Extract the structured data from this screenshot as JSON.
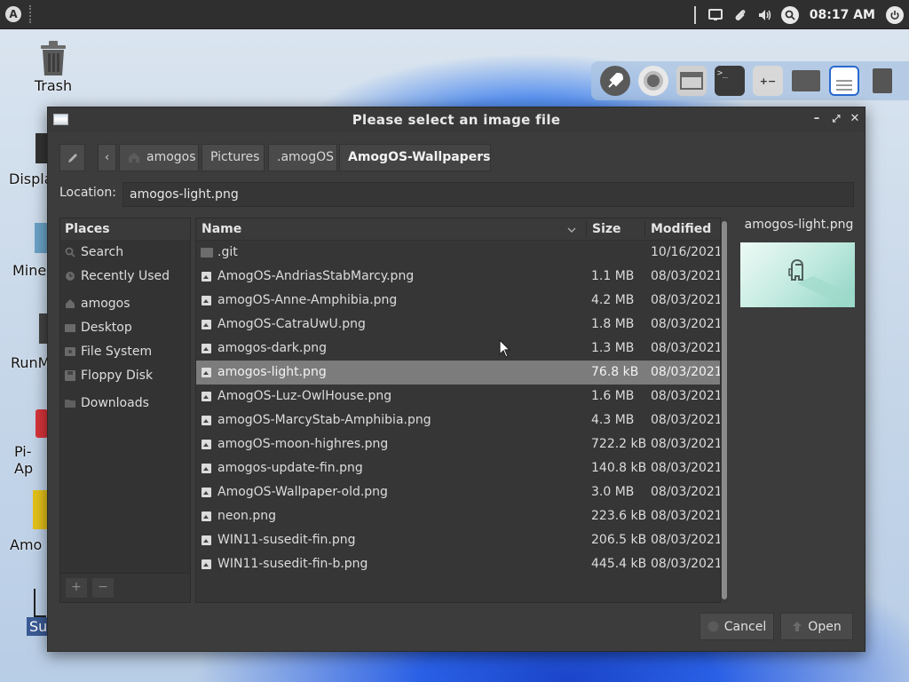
{
  "panel": {
    "clock": "08:17 AM"
  },
  "desktop": {
    "icons": [
      {
        "label": "Trash"
      },
      {
        "label": "Displa"
      },
      {
        "label": "Mine"
      },
      {
        "label": "RunM"
      },
      {
        "label": "Pi-Ap"
      },
      {
        "label": "Amo"
      },
      {
        "label": "Su"
      }
    ]
  },
  "dialog": {
    "title": "Please select an image file",
    "breadcrumb": [
      "amogos",
      "Pictures",
      ".amogOS",
      "AmogOS-Wallpapers"
    ],
    "location_label": "Location:",
    "location_value": "amogos-light.png",
    "places": {
      "header": "Places",
      "items": [
        "Search",
        "Recently Used",
        "amogos",
        "Desktop",
        "File System",
        "Floppy Disk",
        "Downloads"
      ],
      "add_label": "+",
      "remove_label": "−"
    },
    "columns": {
      "name": "Name",
      "size": "Size",
      "modified": "Modified"
    },
    "files": [
      {
        "name": ".git",
        "size": "",
        "modified": "10/16/2021"
      },
      {
        "name": "AmogOS-AndriasStabMarcy.png",
        "size": "1.1 MB",
        "modified": "08/03/2021"
      },
      {
        "name": "amogOS-Anne-Amphibia.png",
        "size": "4.2 MB",
        "modified": "08/03/2021"
      },
      {
        "name": "AmogOS-CatraUwU.png",
        "size": "1.8 MB",
        "modified": "08/03/2021"
      },
      {
        "name": "amogos-dark.png",
        "size": "1.3 MB",
        "modified": "08/03/2021"
      },
      {
        "name": "amogos-light.png",
        "size": "76.8 kB",
        "modified": "08/03/2021"
      },
      {
        "name": "AmogOS-Luz-OwlHouse.png",
        "size": "1.6 MB",
        "modified": "08/03/2021"
      },
      {
        "name": "amogOS-MarcyStab-Amphibia.png",
        "size": "4.3 MB",
        "modified": "08/03/2021"
      },
      {
        "name": "amogOS-moon-highres.png",
        "size": "722.2 kB",
        "modified": "08/03/2021"
      },
      {
        "name": "amogos-update-fin.png",
        "size": "140.8 kB",
        "modified": "08/03/2021"
      },
      {
        "name": "AmogOS-Wallpaper-old.png",
        "size": "3.0 MB",
        "modified": "08/03/2021"
      },
      {
        "name": "neon.png",
        "size": "223.6 kB",
        "modified": "08/03/2021"
      },
      {
        "name": "WIN11-susedit-fin.png",
        "size": "206.5 kB",
        "modified": "08/03/2021"
      },
      {
        "name": "WIN11-susedit-fin-b.png",
        "size": "445.4 kB",
        "modified": "08/03/2021"
      }
    ],
    "preview_name": "amogos-light.png",
    "cancel_label": "Cancel",
    "open_label": "Open"
  }
}
